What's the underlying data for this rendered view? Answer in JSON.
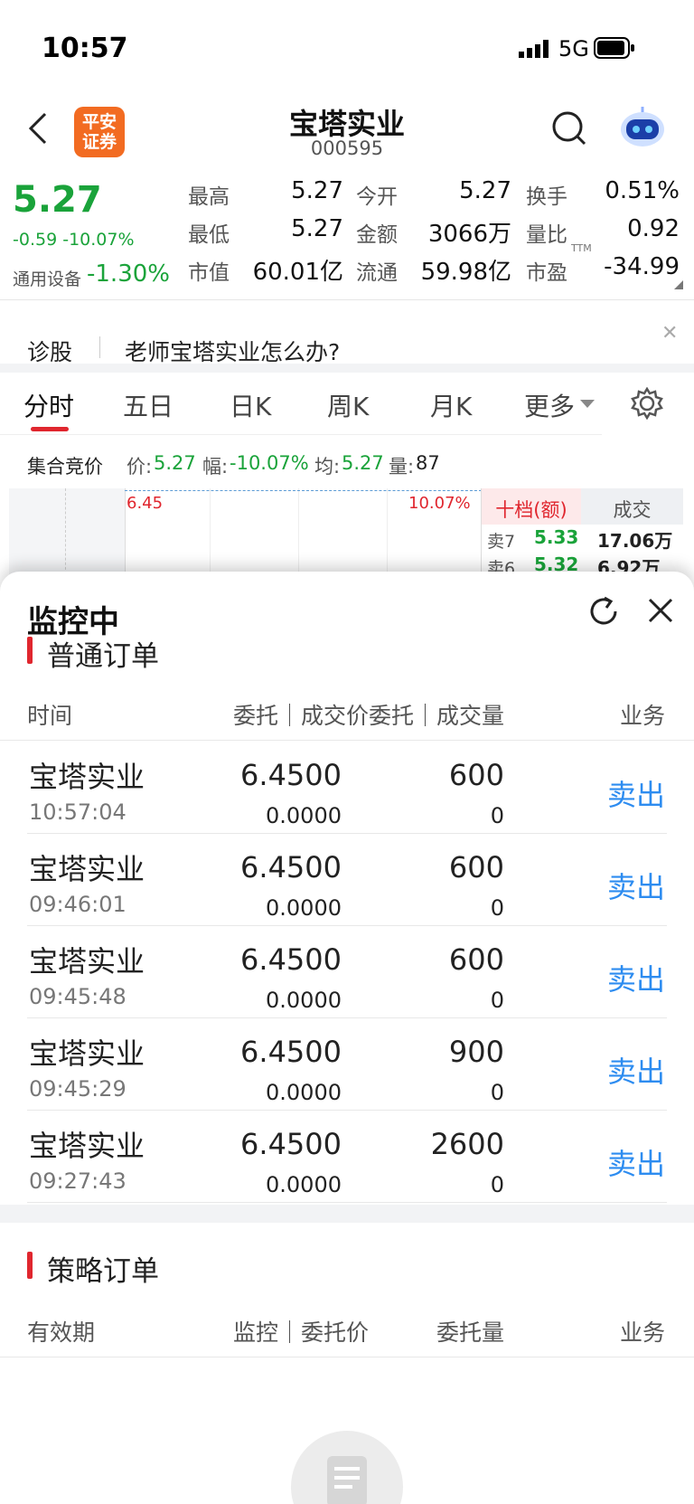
{
  "status": {
    "time": "10:57",
    "network": "5G"
  },
  "nav": {
    "logo": "平安证券",
    "title": "宝塔实业",
    "code": "000595"
  },
  "quote": {
    "price": "5.27",
    "change": "-0.59",
    "change_pct": "-10.07%",
    "sector_name": "通用设备",
    "sector_pct": "-1.30%",
    "items": [
      {
        "label": "最高",
        "value": "5.27"
      },
      {
        "label": "今开",
        "value": "5.27"
      },
      {
        "label": "换手",
        "value": "0.51%"
      },
      {
        "label": "最低",
        "value": "5.27"
      },
      {
        "label": "金额",
        "value": "3066万"
      },
      {
        "label": "量比",
        "value": "0.92"
      },
      {
        "label": "市值",
        "value": "60.01亿"
      },
      {
        "label": "流通",
        "value": "59.98亿"
      },
      {
        "label": "市盈",
        "value": "-34.99"
      }
    ],
    "ttm": "TTM"
  },
  "diagnosis": {
    "label": "诊股",
    "text": "老师宝塔实业怎么办?"
  },
  "tabs": [
    "分时",
    "五日",
    "日K",
    "周K",
    "月K",
    "更多"
  ],
  "auction": {
    "label": "集合竞价",
    "price_label": "价:",
    "price": "5.27",
    "amp_label": "幅:",
    "amp": "-10.07%",
    "avg_label": "均:",
    "avg": "5.27",
    "vol_label": "量:",
    "vol": "87"
  },
  "chart_strip": {
    "high": "6.45",
    "high_pct": "10.07%",
    "tab_active": "十档(额)",
    "tab_other": "成交",
    "asks": [
      {
        "label": "卖7",
        "price": "5.33",
        "amount": "17.06万"
      },
      {
        "label": "卖6",
        "price": "5.32",
        "amount": "6.92万"
      }
    ]
  },
  "sheet": {
    "title": "监控中",
    "normal_title": "普通订单",
    "normal_headers": {
      "time": "时间",
      "price": "委托｜成交价",
      "qty": "委托｜成交量",
      "biz": "业务"
    },
    "orders": [
      {
        "name": "宝塔实业",
        "time": "10:57:04",
        "price": "6.4500",
        "deal_price": "0.0000",
        "qty": "600",
        "deal_qty": "0",
        "biz": "卖出"
      },
      {
        "name": "宝塔实业",
        "time": "09:46:01",
        "price": "6.4500",
        "deal_price": "0.0000",
        "qty": "600",
        "deal_qty": "0",
        "biz": "卖出"
      },
      {
        "name": "宝塔实业",
        "time": "09:45:48",
        "price": "6.4500",
        "deal_price": "0.0000",
        "qty": "600",
        "deal_qty": "0",
        "biz": "卖出"
      },
      {
        "name": "宝塔实业",
        "time": "09:45:29",
        "price": "6.4500",
        "deal_price": "0.0000",
        "qty": "900",
        "deal_qty": "0",
        "biz": "卖出"
      },
      {
        "name": "宝塔实业",
        "time": "09:27:43",
        "price": "6.4500",
        "deal_price": "0.0000",
        "qty": "2600",
        "deal_qty": "0",
        "biz": "卖出"
      }
    ],
    "strategy_title": "策略订单",
    "strategy_headers": {
      "validity": "有效期",
      "price": "监控｜委托价",
      "qty": "委托量",
      "biz": "业务"
    }
  },
  "colors": {
    "up": "#e0262e",
    "down": "#1aa33a",
    "link": "#2d8cf0"
  }
}
